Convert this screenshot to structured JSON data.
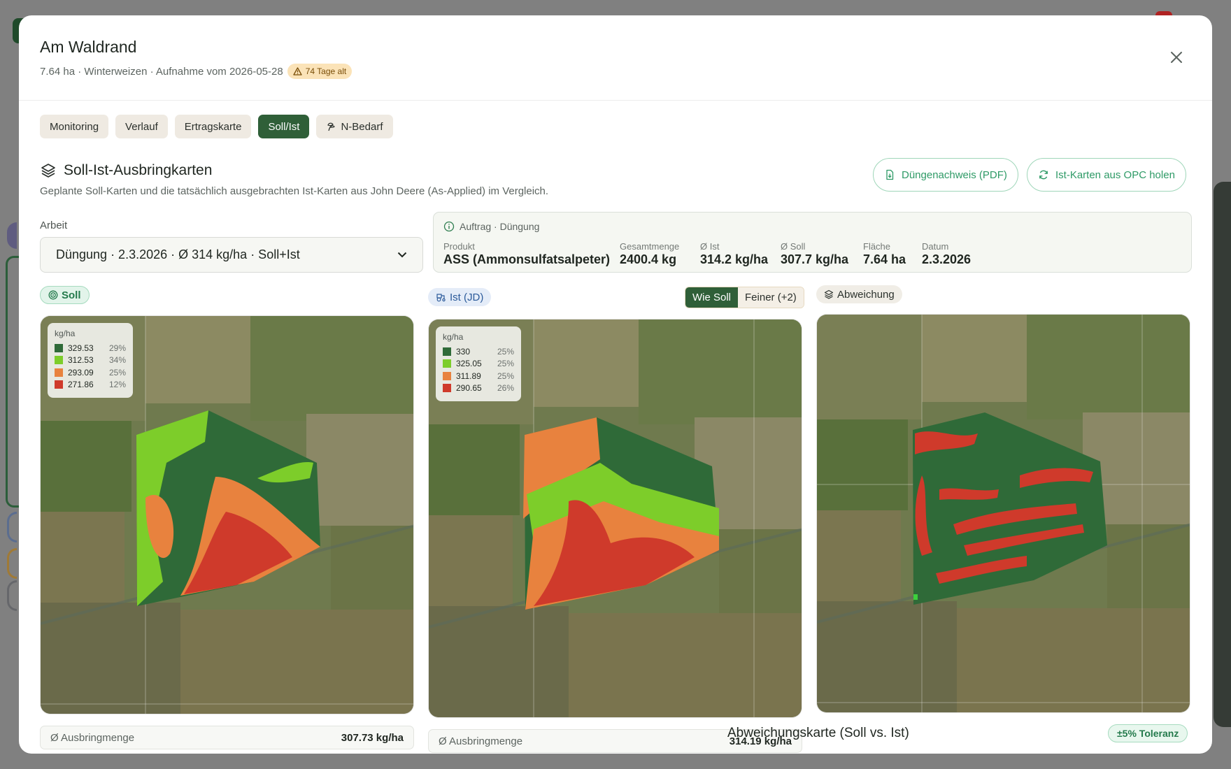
{
  "dialog": {
    "title": "Am Waldrand",
    "subtitle": "7.64 ha · Winterweizen · Aufnahme vom 2026-05-28",
    "age_badge": "74 Tage alt",
    "close_icon": "close-icon"
  },
  "tabs": [
    {
      "label": "Monitoring",
      "active": false
    },
    {
      "label": "Verlauf",
      "active": false
    },
    {
      "label": "Ertragskarte",
      "active": false
    },
    {
      "label": "Soll/Ist",
      "active": true
    },
    {
      "label": "N-Bedarf",
      "active": false,
      "icon": "sprout-icon"
    }
  ],
  "section": {
    "title": "Soll-Ist-Ausbringkarten",
    "description": "Geplante Soll-Karten und die tatsächlich ausgebrachten Ist-Karten aus John Deere (As-Applied) im Vergleich.",
    "pdf_button": "Düngenachweis (PDF)",
    "opc_button": "Ist-Karten aus OPC holen"
  },
  "arbeit": {
    "label": "Arbeit",
    "selected": "Düngung · 2.3.2026 · Ø 314 kg/ha · Soll+Ist"
  },
  "auftrag": {
    "header": "Auftrag · Düngung",
    "stats": [
      {
        "label": "Produkt",
        "value": "ASS (Ammonsulfatsalpeter)"
      },
      {
        "label": "Gesamtmenge",
        "value": "2400.4 kg"
      },
      {
        "label": "Ø Ist",
        "value": "314.2 kg/ha"
      },
      {
        "label": "Ø Soll",
        "value": "307.7 kg/ha"
      },
      {
        "label": "Fläche",
        "value": "7.64 ha"
      },
      {
        "label": "Datum",
        "value": "2.3.2026"
      }
    ]
  },
  "panels": {
    "soll": {
      "pill": "Soll",
      "legend_unit": "kg/ha",
      "legend": [
        {
          "value": "329.53",
          "pct": "29%",
          "color": "#2f6a38"
        },
        {
          "value": "312.53",
          "pct": "34%",
          "color": "#7dcd2a"
        },
        {
          "value": "293.09",
          "pct": "25%",
          "color": "#e8823e"
        },
        {
          "value": "271.86",
          "pct": "12%",
          "color": "#cf3a2b"
        }
      ],
      "avg_label": "Ø Ausbringmenge",
      "avg_value": "307.73 kg/ha"
    },
    "ist": {
      "pill": "Ist (JD)",
      "seg_on": "Wie Soll",
      "seg_off": "Feiner (+2)",
      "legend_unit": "kg/ha",
      "legend": [
        {
          "value": "330",
          "pct": "25%",
          "color": "#2f6a38"
        },
        {
          "value": "325.05",
          "pct": "25%",
          "color": "#7dcd2a"
        },
        {
          "value": "311.89",
          "pct": "25%",
          "color": "#e8823e"
        },
        {
          "value": "290.65",
          "pct": "26%",
          "color": "#cf3a2b"
        }
      ],
      "avg_label": "Ø Ausbringmenge",
      "avg_value": "314.19 kg/ha"
    },
    "abweichung": {
      "pill": "Abweichung",
      "caption": "Abweichungskarte (Soll vs. Ist)",
      "tolerance": "±5% Toleranz"
    }
  },
  "colors": {
    "accent": "#2f5f38",
    "zone_high": "#2f6a38",
    "zone_mid_high": "#7dcd2a",
    "zone_mid_low": "#e8823e",
    "zone_low": "#cf3a2b"
  }
}
